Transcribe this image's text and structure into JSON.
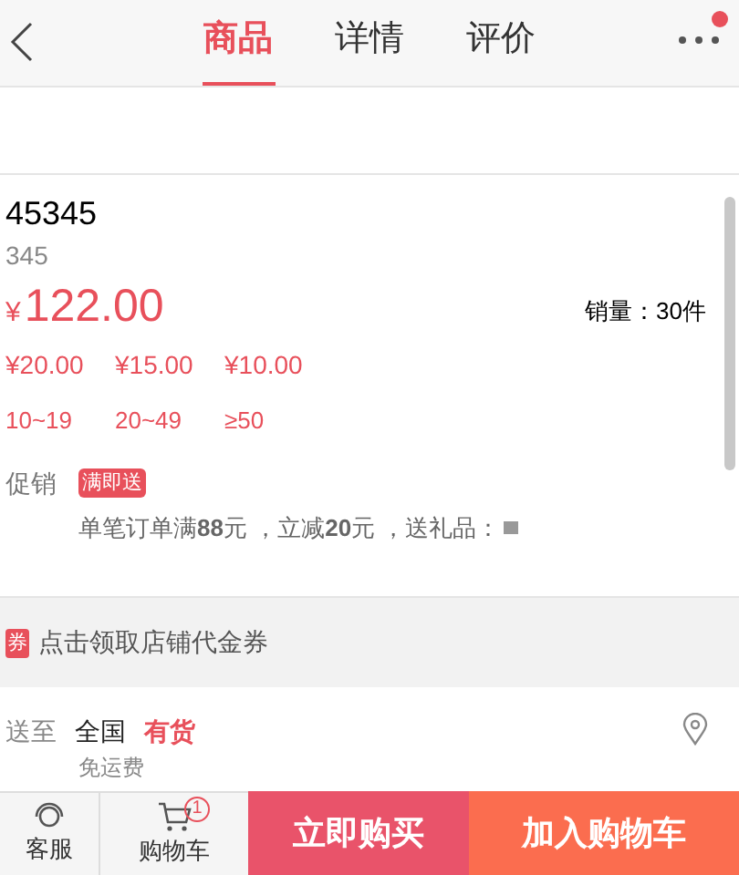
{
  "tabs": [
    {
      "label": "商品",
      "selected": true
    },
    {
      "label": "详情",
      "selected": false
    },
    {
      "label": "评价",
      "selected": false
    }
  ],
  "menu_has_notice": true,
  "product": {
    "title": "45345",
    "subtitle": "345",
    "currency": "¥",
    "price": "122.00",
    "sales": "销量：30件",
    "tier_prices": [
      {
        "price": "¥20.00",
        "range": "10~19"
      },
      {
        "price": "¥15.00",
        "range": "20~49"
      },
      {
        "price": "¥10.00",
        "range": "≥50"
      }
    ]
  },
  "promotion": {
    "label": "促销",
    "tag": "满即送",
    "text": "单笔订单满**88**元 ，立减**20**元 ，送礼品："
  },
  "coupon": {
    "badge": "券",
    "text": "点击领取店铺代金券"
  },
  "shipping": {
    "label": "送至",
    "region": "全国",
    "stock": "有货",
    "fee": "免运费"
  },
  "bottom_bar": {
    "service": "客服",
    "cart": "购物车",
    "cart_count": "1",
    "buy_now": "立即购买",
    "add_to_cart": "加入购物车"
  }
}
